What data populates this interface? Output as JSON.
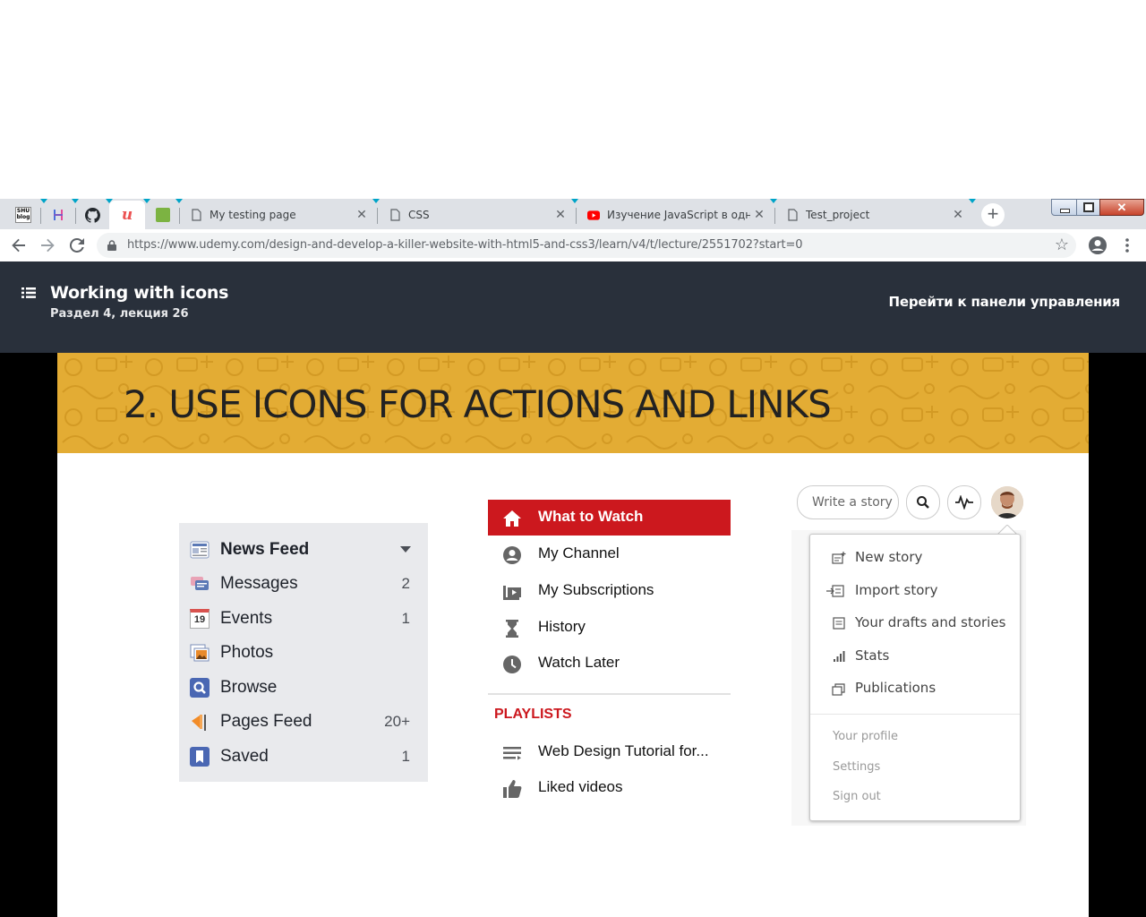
{
  "browser": {
    "pinned_tabs": [
      {
        "name": "shu-blog-tab",
        "icon": "shu-blog-favicon",
        "label": "SHU blog"
      },
      {
        "name": "h-tab",
        "icon": "h-favicon"
      },
      {
        "name": "github-tab",
        "icon": "github-icon"
      },
      {
        "name": "udemy-tab",
        "icon": "udemy-icon",
        "active": true
      },
      {
        "name": "green-tab",
        "icon": "green-favicon"
      }
    ],
    "tabs": [
      {
        "title": "My testing page",
        "icon": "page-icon"
      },
      {
        "title": "CSS",
        "icon": "page-icon"
      },
      {
        "title": "Изучение JavaScript в одном",
        "icon": "youtube-icon"
      },
      {
        "title": "Test_project",
        "icon": "page-icon"
      }
    ],
    "close_glyph": "✕",
    "new_tab_glyph": "+",
    "url": "https://www.udemy.com/design-and-develop-a-killer-website-with-html5-and-css3/learn/v4/t/lecture/2551702?start=0"
  },
  "udemy": {
    "lecture_title": "Working with icons",
    "lecture_subtitle": "Раздел 4, лекция 26",
    "dashboard_link": "Перейти к панели управления",
    "accent": "#29303b"
  },
  "slide": {
    "heading": "2. USE ICONS FOR ACTIONS AND LINKS",
    "banner_color": "#e3ac34",
    "facebook": {
      "items": [
        {
          "label": "News Feed",
          "icon": "news-feed-icon",
          "count": "",
          "bold": true,
          "dropdown": true
        },
        {
          "label": "Messages",
          "icon": "messages-icon",
          "count": "2"
        },
        {
          "label": "Events",
          "icon": "calendar-icon",
          "icon_text": "19",
          "count": "1"
        },
        {
          "label": "Photos",
          "icon": "photos-icon",
          "count": ""
        },
        {
          "label": "Browse",
          "icon": "search-icon",
          "count": ""
        },
        {
          "label": "Pages Feed",
          "icon": "flag-icon",
          "count": "20+"
        },
        {
          "label": "Saved",
          "icon": "bookmark-icon",
          "count": "1"
        }
      ]
    },
    "youtube": {
      "items": [
        {
          "label": "What to Watch",
          "icon": "home-icon",
          "active": true
        },
        {
          "label": "My Channel",
          "icon": "user-circle-icon"
        },
        {
          "label": "My Subscriptions",
          "icon": "subscriptions-icon"
        },
        {
          "label": "History",
          "icon": "hourglass-icon"
        },
        {
          "label": "Watch Later",
          "icon": "clock-icon"
        }
      ],
      "playlists_heading": "PLAYLISTS",
      "playlists": [
        {
          "label": "Web Design Tutorial for...",
          "icon": "playlist-icon"
        },
        {
          "label": "Liked videos",
          "icon": "thumbs-up-icon"
        }
      ],
      "accent": "#cc181e"
    },
    "medium": {
      "write_button": "Write a story",
      "menu_items": [
        {
          "label": "New story",
          "icon": "new-story-icon"
        },
        {
          "label": "Import story",
          "icon": "import-icon"
        },
        {
          "label": "Your drafts and stories",
          "icon": "drafts-icon"
        },
        {
          "label": "Stats",
          "icon": "stats-icon"
        },
        {
          "label": "Publications",
          "icon": "publications-icon"
        }
      ],
      "secondary_items": [
        "Your profile",
        "Settings",
        "Sign out"
      ]
    }
  }
}
